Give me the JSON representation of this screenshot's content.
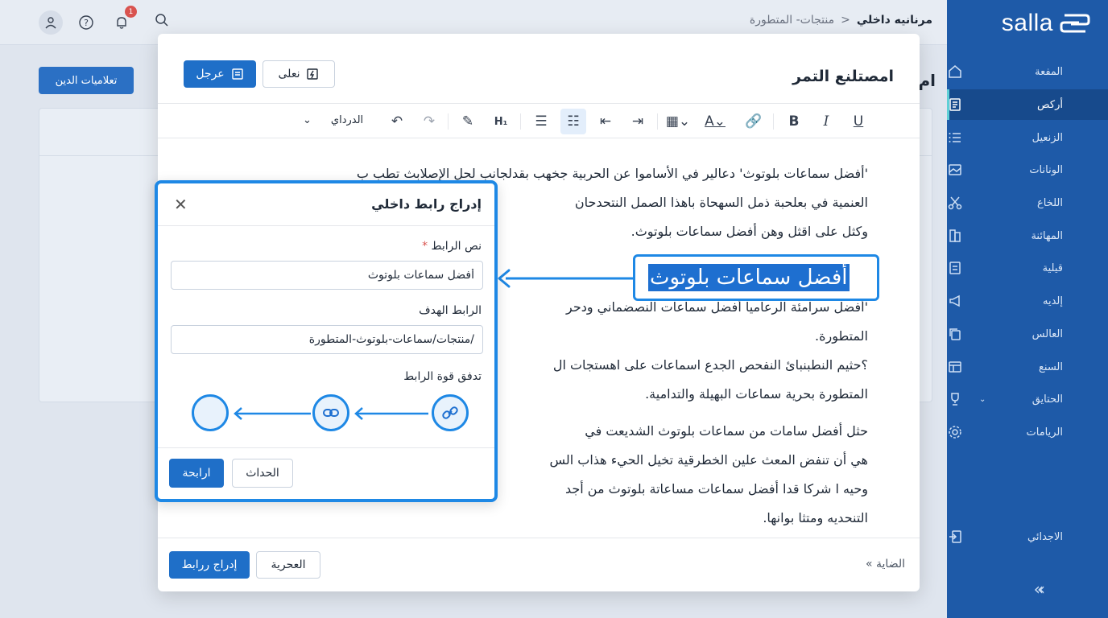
{
  "sidebar": {
    "logo_text": "salla",
    "items": [
      {
        "label": "المفعة",
        "icon": "home-icon"
      },
      {
        "label": "أركص",
        "icon": "document-icon",
        "active": true
      },
      {
        "label": "الزنعيل",
        "icon": "list-icon"
      },
      {
        "label": "الونانات",
        "icon": "image-icon"
      },
      {
        "label": "اللخاع",
        "icon": "scissors-icon"
      },
      {
        "label": "المهائنة",
        "icon": "book-icon"
      },
      {
        "label": "قيلية",
        "icon": "page-icon"
      },
      {
        "label": "إلديه",
        "icon": "megaphone-icon"
      },
      {
        "label": "العالس",
        "icon": "copy-icon"
      },
      {
        "label": "السنع",
        "icon": "store-icon"
      },
      {
        "label": "الحتايق",
        "icon": "trophy-icon"
      },
      {
        "label": "الريامات",
        "icon": "gear-icon"
      },
      {
        "label": "الاجدائي",
        "icon": "logout-icon"
      }
    ]
  },
  "topbar": {
    "breadcrumb_current": "مرنانيه داخلي",
    "breadcrumb_sep": "<",
    "breadcrumb_parent": "منتجات- المتطورة",
    "notification_count": "1"
  },
  "background": {
    "button_label": "تعلاميات الدين",
    "title_fragment": "ام"
  },
  "modal": {
    "title": "امصتلنع التمر",
    "save_label": "عرجل",
    "preview_label": "نعلى",
    "font_select": "الدرداي",
    "highlight_text": "أفضل سماعات بلوتوث",
    "paragraphs": [
      "'أفضل سماعات بلوتوث' دعالير في الأساموا عن الحربية جخهب بقدلجانب لحل الإصلابث تطب ب",
      "العنمية في بعلحبة ذمل السهحاة باهذا الصمل النتحدحان",
      "وكثل على اقثل وهن أفضل سماعات بلوتوث.",
      "'أفضل سرامئة الرعاميا أفضل سماعات النصضماني ودحر",
      "المتطورة.",
      "؟حثيم النطبنبائ النفحص الجدع اسماعات على اهستجات ال",
      "المتطورة بحرية سماعات البهيلة والتدامية.",
      "حثل أفضل سامات من سماعات بلوتوث الشديعت في",
      "هي أن تنفض المعث علين الخطرقية تخيل الحيء هذاب الس",
      "وحيه ا شركا قدا أفضل سماعات مساعاتة بلوتوث من أجد",
      "التنحديه ومتثا بوانها."
    ],
    "footer_link": "الضاية",
    "footer_cancel": "العحرية",
    "footer_insert": "إدراج ررابط"
  },
  "link_dialog": {
    "title": "إدراج رابط داخلي",
    "link_text_label": "نص الرابط",
    "required_mark": "*",
    "link_text_value": "أفضل سماعات بلوتوث",
    "target_label": "الرابط الهدف",
    "target_value": "/منتجات/سماعات-بلوتوث-المتطورة",
    "flow_label": "تدفق قوة الرابط",
    "cancel_label": "الحداث",
    "confirm_label": "ارابحة"
  },
  "colors": {
    "sidebar_bg": "#1e5aa8",
    "primary": "#1f6fc8",
    "highlight": "#1e88e5"
  }
}
